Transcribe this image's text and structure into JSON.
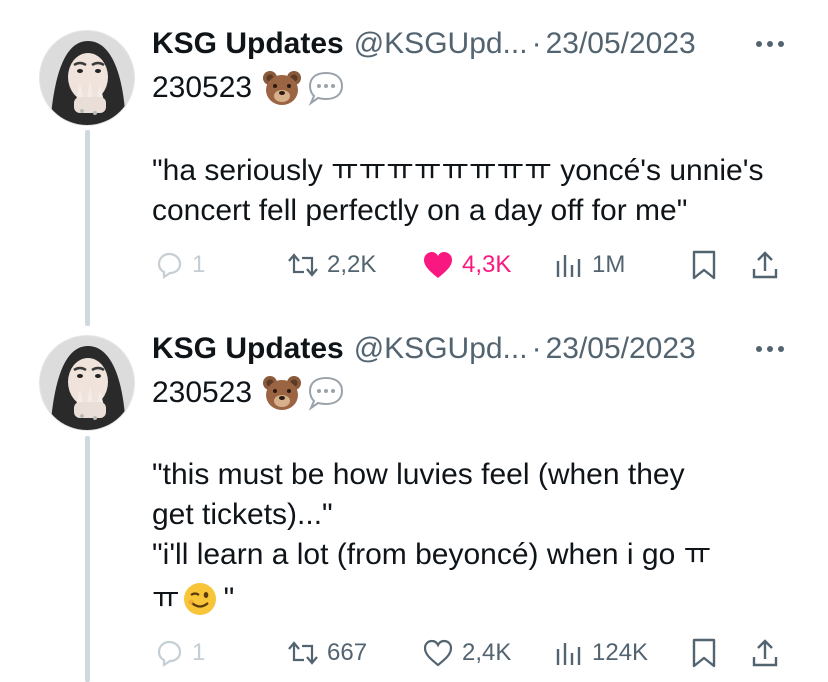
{
  "tweets": [
    {
      "author_name": "KSG Updates",
      "handle": "@KSGUpd...",
      "separator": "·",
      "date": "23/05/2023",
      "date_code": "230523",
      "body": "\"ha seriously ㅠㅠㅠㅠㅠㅠㅠㅠ yoncé's unnie's\nconcert fell perfectly on a day off for me\"",
      "replies": "1",
      "retweets": "2,2K",
      "likes": "4,3K",
      "liked": true,
      "views": "1M"
    },
    {
      "author_name": "KSG Updates",
      "handle": "@KSGUpd...",
      "separator": "·",
      "date": "23/05/2023",
      "date_code": "230523",
      "body_line1": "\"this must be how luvies feel (when they\nget tickets)...\"\n\"i'll learn a lot (from beyoncé) when i go ㅠ",
      "body_line2": "ㅠ",
      "body_tail": "\"",
      "replies": "1",
      "retweets": "667",
      "likes": "2,4K",
      "liked": false,
      "views": "124K"
    }
  ],
  "icons": {
    "bear": "bear-face-icon",
    "speech": "speech-balloon-icon",
    "wink": "winking-face-icon"
  },
  "colors": {
    "text": "#0f1419",
    "secondary": "#536471",
    "like_active": "#f91880",
    "thread_line": "#cfd9de"
  }
}
